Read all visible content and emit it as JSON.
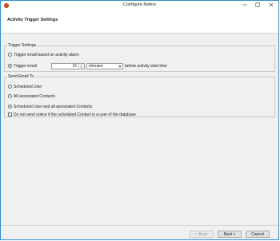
{
  "window": {
    "title": "Configure Notice",
    "controls": [
      "minimize",
      "maximize",
      "close"
    ]
  },
  "header": {
    "title": "Activity Trigger Settings"
  },
  "trigger_settings": {
    "legend": "Trigger Settings",
    "option_alarm": "Trigger email based on activity alarm",
    "option_email": "Trigger email",
    "selected": "option_email",
    "amount": "15",
    "unit": "minutes",
    "after_text": "before activity start time"
  },
  "send_email_to": {
    "legend": "Send Email To",
    "options": [
      "Scheduled User",
      "All associated Contacts",
      "Scheduled User and all associated Contacts"
    ],
    "selected_index": 2,
    "checkbox_label": "Do not send notice if the scheduled Contact is a user of the database",
    "checkbox_checked": false
  },
  "footer": {
    "back_label": "< Back",
    "next_label": "Next >",
    "cancel_label": "Cancel"
  }
}
